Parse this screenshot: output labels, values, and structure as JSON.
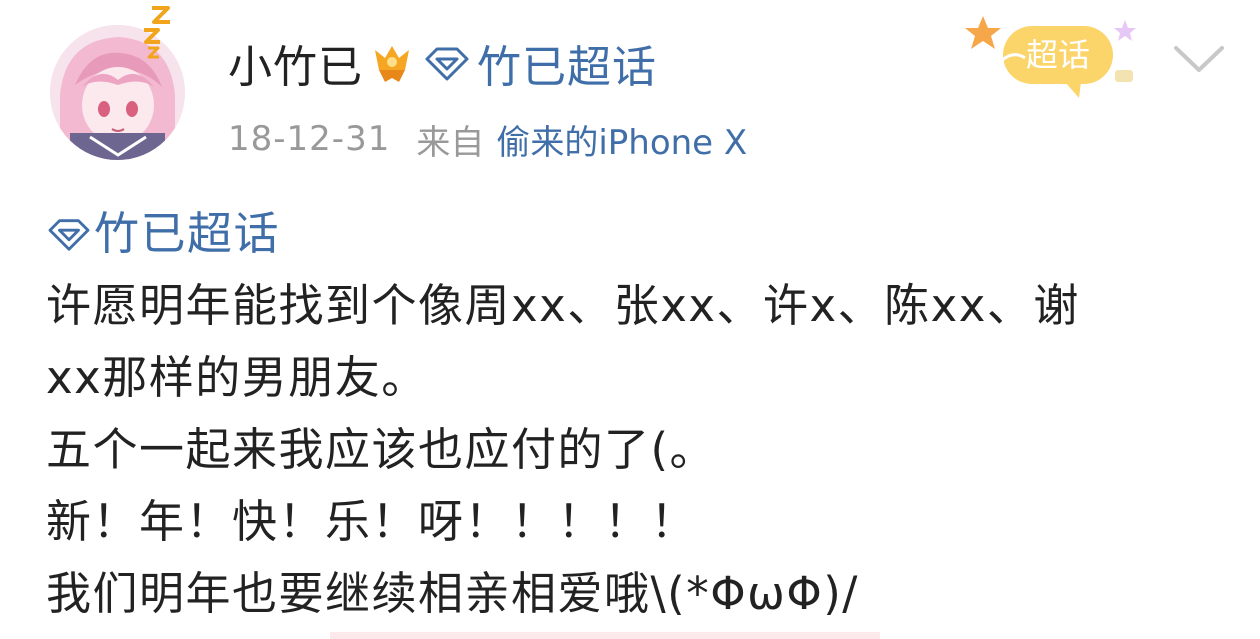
{
  "header": {
    "username": "小竹已",
    "topic_link": "竹已超话",
    "date": "18-12-31",
    "from_label": "来自",
    "device": "偷来的iPhone X",
    "tag_label": "超话"
  },
  "content": {
    "topic": "竹已超话",
    "lines": [
      "许愿明年能找到个像周xx、张xx、许x、陈xx、谢",
      "xx那样的男朋友。",
      "五个一起来我应该也应付的了(。",
      "新！年！快！乐！呀！！！！！",
      "我们明年也要继续相亲相爱哦\\(*ΦωΦ)/"
    ]
  },
  "icons": {
    "badge": "orange-crown-badge-icon",
    "diamond": "supertopic-diamond-icon",
    "chevron": "chevron-down-icon",
    "zzz": "sleep-zzz-icon"
  },
  "colors": {
    "link": "#3f6ea8",
    "meta": "#999999",
    "text": "#222222",
    "badge": "#f0a21c"
  }
}
